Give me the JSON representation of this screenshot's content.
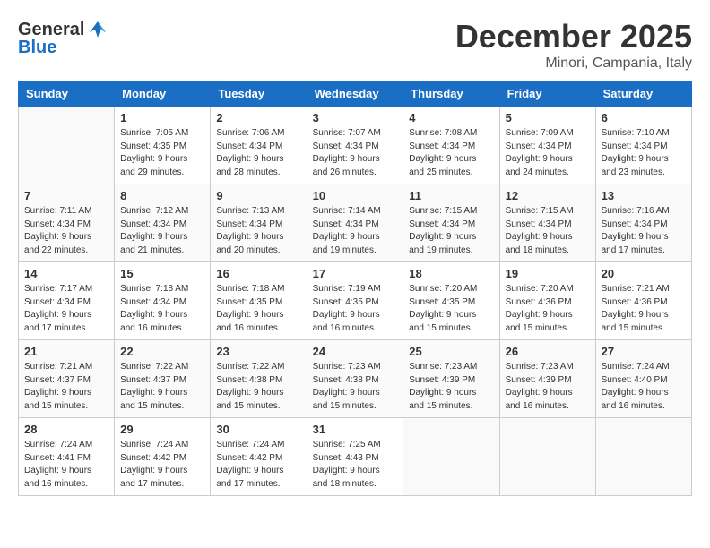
{
  "header": {
    "logo_general": "General",
    "logo_blue": "Blue",
    "month": "December 2025",
    "location": "Minori, Campania, Italy"
  },
  "weekdays": [
    "Sunday",
    "Monday",
    "Tuesday",
    "Wednesday",
    "Thursday",
    "Friday",
    "Saturday"
  ],
  "weeks": [
    [
      {
        "day": "",
        "info": ""
      },
      {
        "day": "1",
        "info": "Sunrise: 7:05 AM\nSunset: 4:35 PM\nDaylight: 9 hours\nand 29 minutes."
      },
      {
        "day": "2",
        "info": "Sunrise: 7:06 AM\nSunset: 4:34 PM\nDaylight: 9 hours\nand 28 minutes."
      },
      {
        "day": "3",
        "info": "Sunrise: 7:07 AM\nSunset: 4:34 PM\nDaylight: 9 hours\nand 26 minutes."
      },
      {
        "day": "4",
        "info": "Sunrise: 7:08 AM\nSunset: 4:34 PM\nDaylight: 9 hours\nand 25 minutes."
      },
      {
        "day": "5",
        "info": "Sunrise: 7:09 AM\nSunset: 4:34 PM\nDaylight: 9 hours\nand 24 minutes."
      },
      {
        "day": "6",
        "info": "Sunrise: 7:10 AM\nSunset: 4:34 PM\nDaylight: 9 hours\nand 23 minutes."
      }
    ],
    [
      {
        "day": "7",
        "info": "Sunrise: 7:11 AM\nSunset: 4:34 PM\nDaylight: 9 hours\nand 22 minutes."
      },
      {
        "day": "8",
        "info": "Sunrise: 7:12 AM\nSunset: 4:34 PM\nDaylight: 9 hours\nand 21 minutes."
      },
      {
        "day": "9",
        "info": "Sunrise: 7:13 AM\nSunset: 4:34 PM\nDaylight: 9 hours\nand 20 minutes."
      },
      {
        "day": "10",
        "info": "Sunrise: 7:14 AM\nSunset: 4:34 PM\nDaylight: 9 hours\nand 19 minutes."
      },
      {
        "day": "11",
        "info": "Sunrise: 7:15 AM\nSunset: 4:34 PM\nDaylight: 9 hours\nand 19 minutes."
      },
      {
        "day": "12",
        "info": "Sunrise: 7:15 AM\nSunset: 4:34 PM\nDaylight: 9 hours\nand 18 minutes."
      },
      {
        "day": "13",
        "info": "Sunrise: 7:16 AM\nSunset: 4:34 PM\nDaylight: 9 hours\nand 17 minutes."
      }
    ],
    [
      {
        "day": "14",
        "info": "Sunrise: 7:17 AM\nSunset: 4:34 PM\nDaylight: 9 hours\nand 17 minutes."
      },
      {
        "day": "15",
        "info": "Sunrise: 7:18 AM\nSunset: 4:34 PM\nDaylight: 9 hours\nand 16 minutes."
      },
      {
        "day": "16",
        "info": "Sunrise: 7:18 AM\nSunset: 4:35 PM\nDaylight: 9 hours\nand 16 minutes."
      },
      {
        "day": "17",
        "info": "Sunrise: 7:19 AM\nSunset: 4:35 PM\nDaylight: 9 hours\nand 16 minutes."
      },
      {
        "day": "18",
        "info": "Sunrise: 7:20 AM\nSunset: 4:35 PM\nDaylight: 9 hours\nand 15 minutes."
      },
      {
        "day": "19",
        "info": "Sunrise: 7:20 AM\nSunset: 4:36 PM\nDaylight: 9 hours\nand 15 minutes."
      },
      {
        "day": "20",
        "info": "Sunrise: 7:21 AM\nSunset: 4:36 PM\nDaylight: 9 hours\nand 15 minutes."
      }
    ],
    [
      {
        "day": "21",
        "info": "Sunrise: 7:21 AM\nSunset: 4:37 PM\nDaylight: 9 hours\nand 15 minutes."
      },
      {
        "day": "22",
        "info": "Sunrise: 7:22 AM\nSunset: 4:37 PM\nDaylight: 9 hours\nand 15 minutes."
      },
      {
        "day": "23",
        "info": "Sunrise: 7:22 AM\nSunset: 4:38 PM\nDaylight: 9 hours\nand 15 minutes."
      },
      {
        "day": "24",
        "info": "Sunrise: 7:23 AM\nSunset: 4:38 PM\nDaylight: 9 hours\nand 15 minutes."
      },
      {
        "day": "25",
        "info": "Sunrise: 7:23 AM\nSunset: 4:39 PM\nDaylight: 9 hours\nand 15 minutes."
      },
      {
        "day": "26",
        "info": "Sunrise: 7:23 AM\nSunset: 4:39 PM\nDaylight: 9 hours\nand 16 minutes."
      },
      {
        "day": "27",
        "info": "Sunrise: 7:24 AM\nSunset: 4:40 PM\nDaylight: 9 hours\nand 16 minutes."
      }
    ],
    [
      {
        "day": "28",
        "info": "Sunrise: 7:24 AM\nSunset: 4:41 PM\nDaylight: 9 hours\nand 16 minutes."
      },
      {
        "day": "29",
        "info": "Sunrise: 7:24 AM\nSunset: 4:42 PM\nDaylight: 9 hours\nand 17 minutes."
      },
      {
        "day": "30",
        "info": "Sunrise: 7:24 AM\nSunset: 4:42 PM\nDaylight: 9 hours\nand 17 minutes."
      },
      {
        "day": "31",
        "info": "Sunrise: 7:25 AM\nSunset: 4:43 PM\nDaylight: 9 hours\nand 18 minutes."
      },
      {
        "day": "",
        "info": ""
      },
      {
        "day": "",
        "info": ""
      },
      {
        "day": "",
        "info": ""
      }
    ]
  ]
}
